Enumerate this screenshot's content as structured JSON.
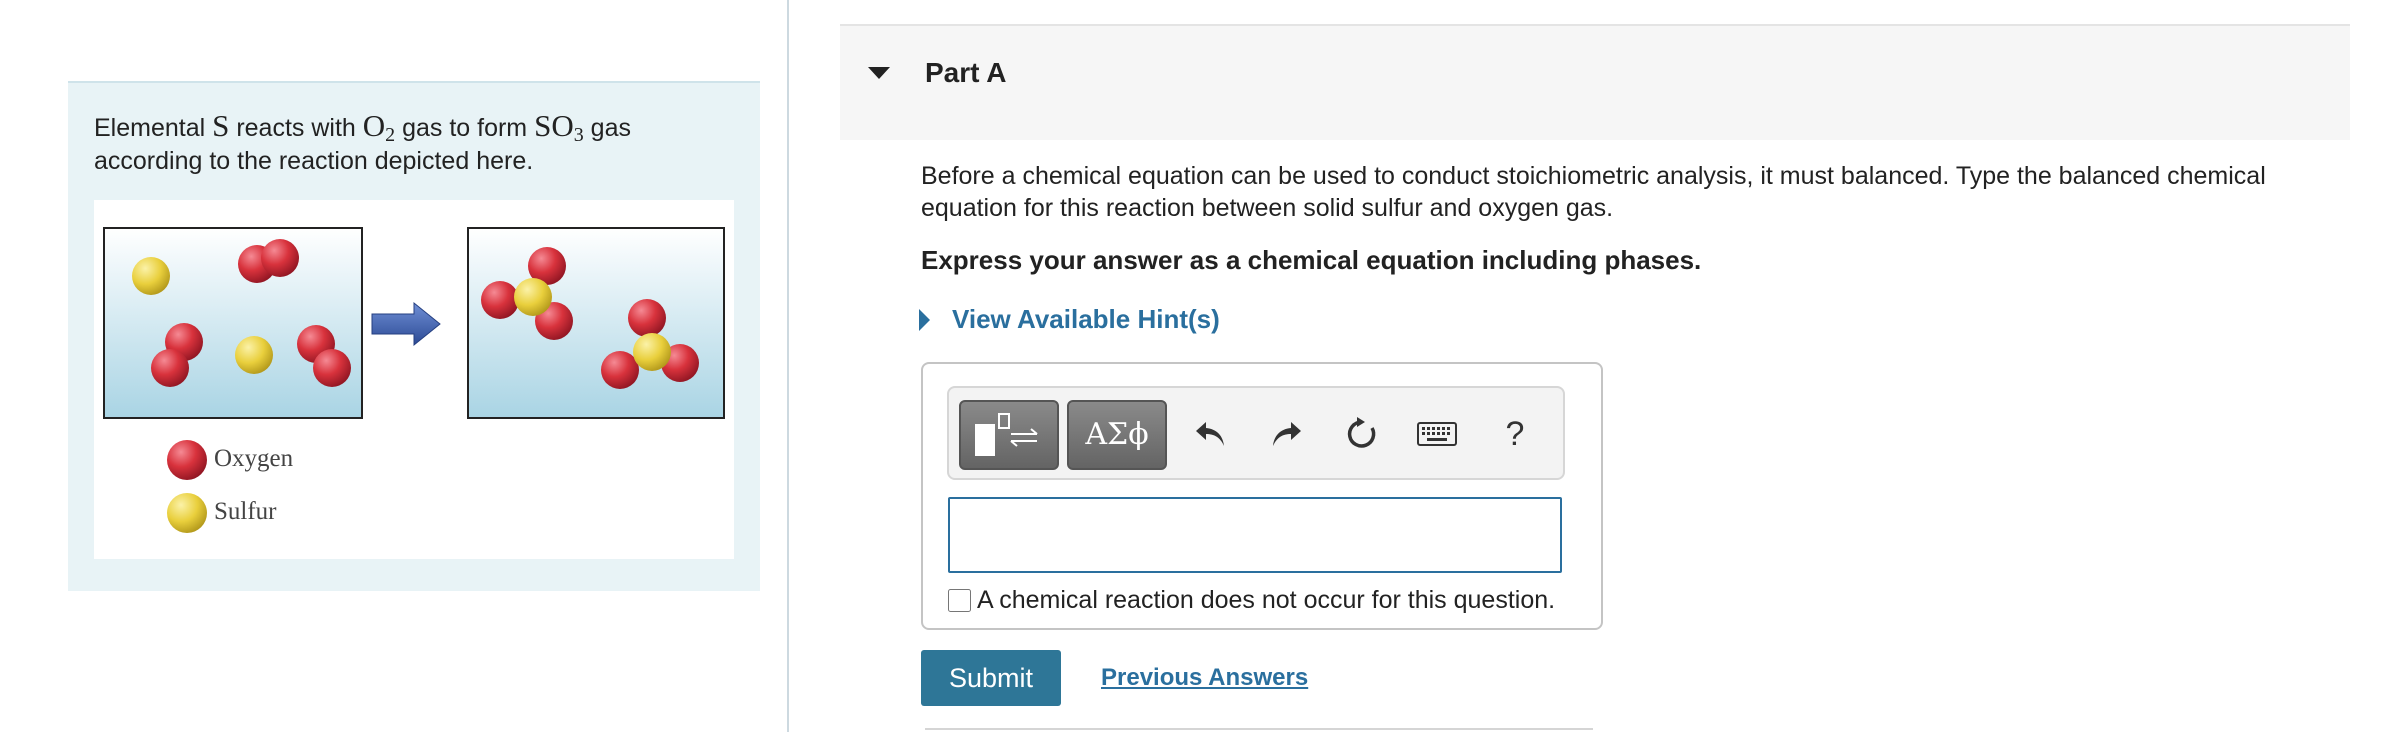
{
  "intro": {
    "text_1": "Elemental ",
    "element_s": "S",
    "text_2": " reacts with ",
    "o2_base": "O",
    "o2_sub": "2",
    "text_3": " gas to form ",
    "so3_base": "SO",
    "so3_sub": "3",
    "text_4": " gas according to the reaction depicted here."
  },
  "figure": {
    "legend": [
      {
        "label": "Oxygen",
        "color": "#d8323c"
      },
      {
        "label": "Sulfur",
        "color": "#e9cf3c"
      }
    ],
    "arrow_color": "#3a5ca8"
  },
  "part": {
    "title": "Part A"
  },
  "question": {
    "text": "Before a chemical equation can be used to conduct stoichiometric analysis, it must balanced. Type the balanced chemical equation for this reaction between solid sulfur and oxygen gas.",
    "instruction": "Express your answer as a chemical equation including phases.",
    "hint_label": "View Available Hint(s)"
  },
  "toolbar": {
    "greek_label": "ΑΣϕ",
    "help_label": "?",
    "icons": [
      "templates-icon",
      "undo-icon",
      "redo-icon",
      "reset-icon",
      "keyboard-icon",
      "help-icon"
    ]
  },
  "answer": {
    "value": "",
    "no_reaction_label": "A chemical reaction does not occur for this question.",
    "no_reaction_checked": false
  },
  "actions": {
    "submit_label": "Submit",
    "previous_label": "Previous Answers"
  },
  "colors": {
    "link": "#2a6f9e",
    "submit": "#2e7697",
    "panel_bg": "#e8f3f6"
  }
}
